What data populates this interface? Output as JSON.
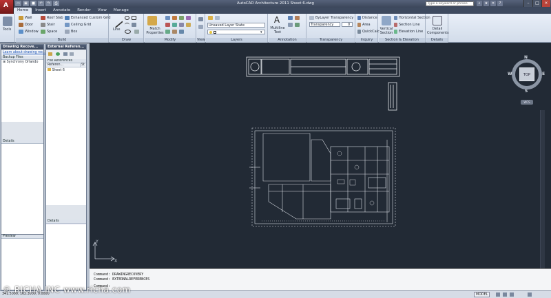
{
  "app": {
    "title": "AutoCAD Architecture 2011    Sheet 6.dwg",
    "help_placeholder": "Type a keyword or phrase"
  },
  "tabs": [
    "Home",
    "Insert",
    "Annotate",
    "Render",
    "View",
    "Manage"
  ],
  "ribbon": {
    "tools_label": "Tools",
    "build": {
      "title": "Build",
      "items": [
        "Wall",
        "Door",
        "Window",
        "Roof Slab",
        "Stair",
        "Space",
        "Enhanced Custom Grid",
        "Ceiling Grid",
        "Box"
      ]
    },
    "draw": {
      "title": "Draw",
      "line_label": "Line"
    },
    "modify": {
      "title": "Modify",
      "match_label": "Match Properties"
    },
    "view": {
      "title": "View"
    },
    "layers": {
      "title": "Layers",
      "layer_state": "Unsaved Layer State"
    },
    "annotation": {
      "title": "Annotation",
      "mtext_label": "Multiline Text"
    },
    "transparency": {
      "title": "Transparency",
      "bylayer": "ByLayer Transparency",
      "label": "Transparency",
      "value": "0"
    },
    "inquiry": {
      "title": "Inquiry",
      "items": [
        "Distance",
        "Area",
        "QuickCalc"
      ]
    },
    "section": {
      "title": "Section & Elevation",
      "vertical_label": "Vertical Section",
      "items": [
        "Horizontal Section",
        "Section Line",
        "Elevation Line"
      ]
    },
    "details": {
      "title": "Details",
      "component_label": "Detail Components"
    }
  },
  "drawing_recovery": {
    "title": "Drawing Recove...",
    "link": "Learn about drawing rec...",
    "backup_files": "Backup Files",
    "backup_item": "Synchrony Orlando",
    "details": "Details",
    "preview": "Preview"
  },
  "external_references": {
    "title": "External Referen...",
    "file_refs": "File References",
    "col_reference": "Referen...",
    "col_status": "St",
    "row": "Sheet 6",
    "details": "Details"
  },
  "viewcube": {
    "top": "TOP",
    "n": "N",
    "s": "S",
    "e": "E",
    "w": "W",
    "wcs": "WCS"
  },
  "command": {
    "history": [
      "Command: DRAWINGRECOVERY",
      "Command: EXTERNALREFERENCES"
    ],
    "prompt": "Command:"
  },
  "status": {
    "coords": "341.5000, 162.3000, 0.0000",
    "model": "MODEL"
  },
  "watermark": "© RICHA INC  www.richa.com"
}
